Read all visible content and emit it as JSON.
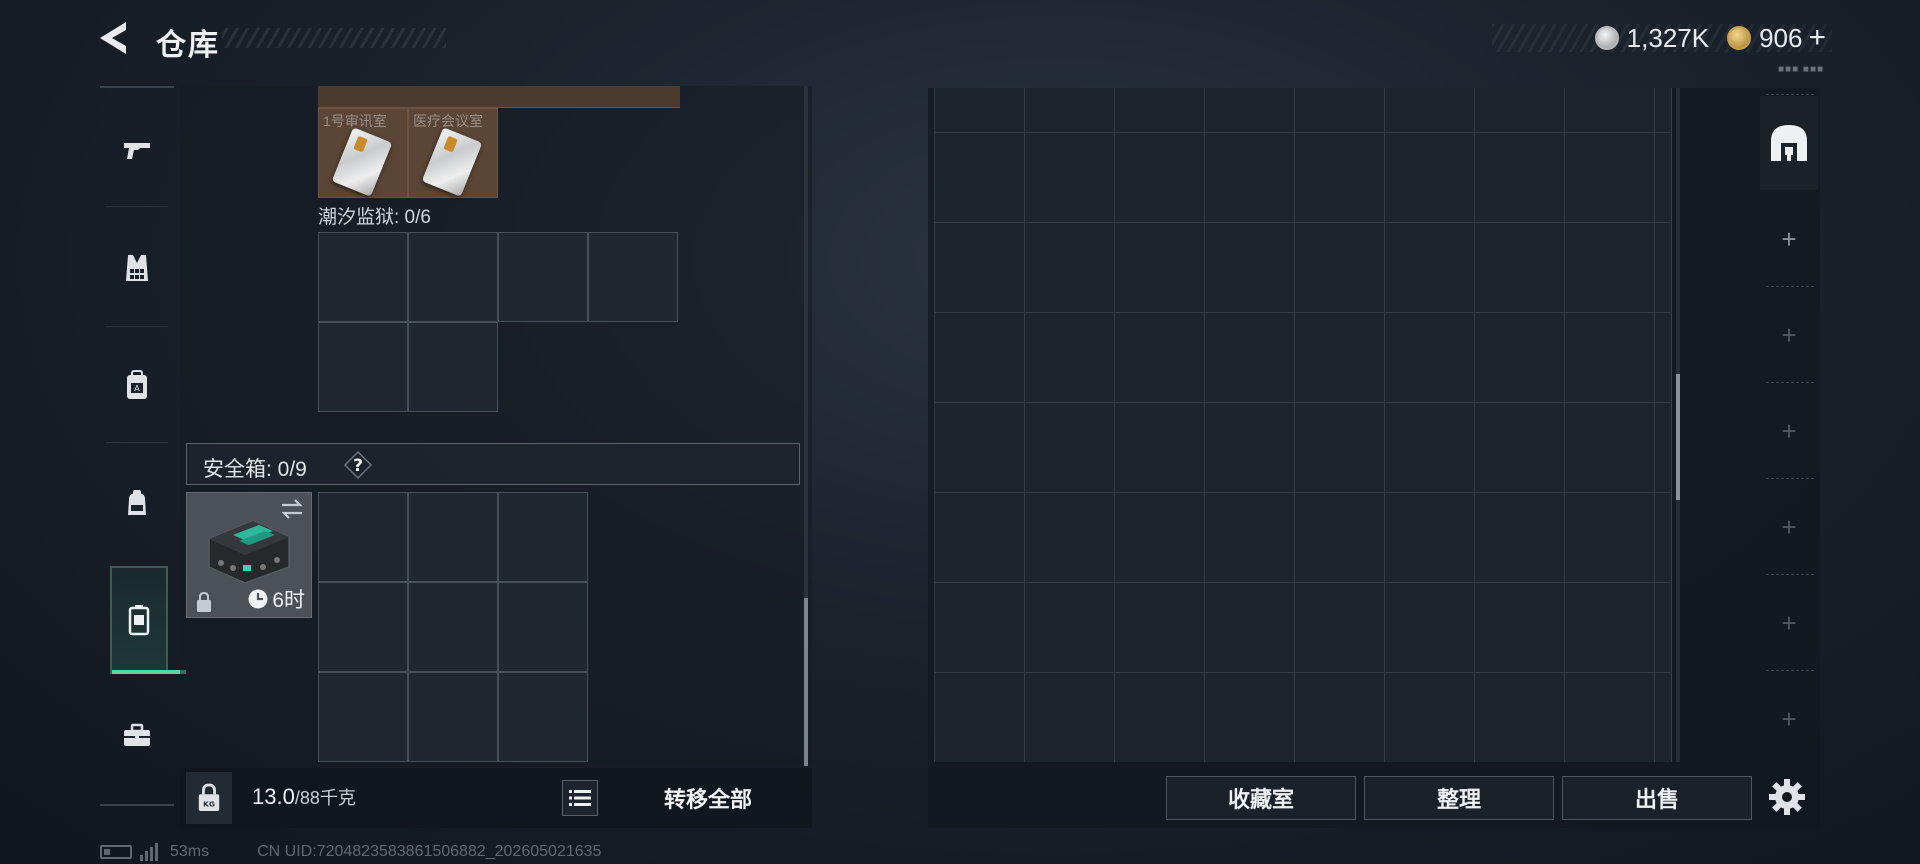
{
  "header": {
    "title": "仓库",
    "currency": [
      {
        "icon": "silver-coin-icon",
        "value": "1,327K"
      },
      {
        "icon": "gold-coin-icon",
        "value": "906"
      }
    ],
    "plus_label": "+",
    "tiny_label": "■■■ ■■■"
  },
  "sidebar": {
    "items": [
      {
        "icon": "gun-icon"
      },
      {
        "icon": "vest-icon"
      },
      {
        "icon": "backpack-icon"
      },
      {
        "icon": "pouch-icon"
      },
      {
        "icon": "safe-case-icon",
        "active": true
      },
      {
        "icon": "toolbox-icon"
      }
    ]
  },
  "left": {
    "keycards": [
      {
        "name": "1号审讯室"
      },
      {
        "name": "医疗会议室"
      }
    ],
    "prison_label": "潮汐监狱: 0/6",
    "safe_label": "安全箱: 0/9",
    "safe_help": "?",
    "safe_timer": "6时",
    "weight_value": "13.0",
    "weight_max": "/88千克",
    "transfer_all": "转移全部"
  },
  "right": {
    "buttons": {
      "collection": "收藏室",
      "sort": "整理",
      "sell": "出售"
    },
    "stash_tab_plus": "+"
  },
  "status": {
    "ping": "53ms",
    "uid": "CN UID:7204823583861506882_202605021635"
  },
  "colors": {
    "accent_green": "#5bd5a3",
    "keycard_bg": "#5a4536"
  }
}
